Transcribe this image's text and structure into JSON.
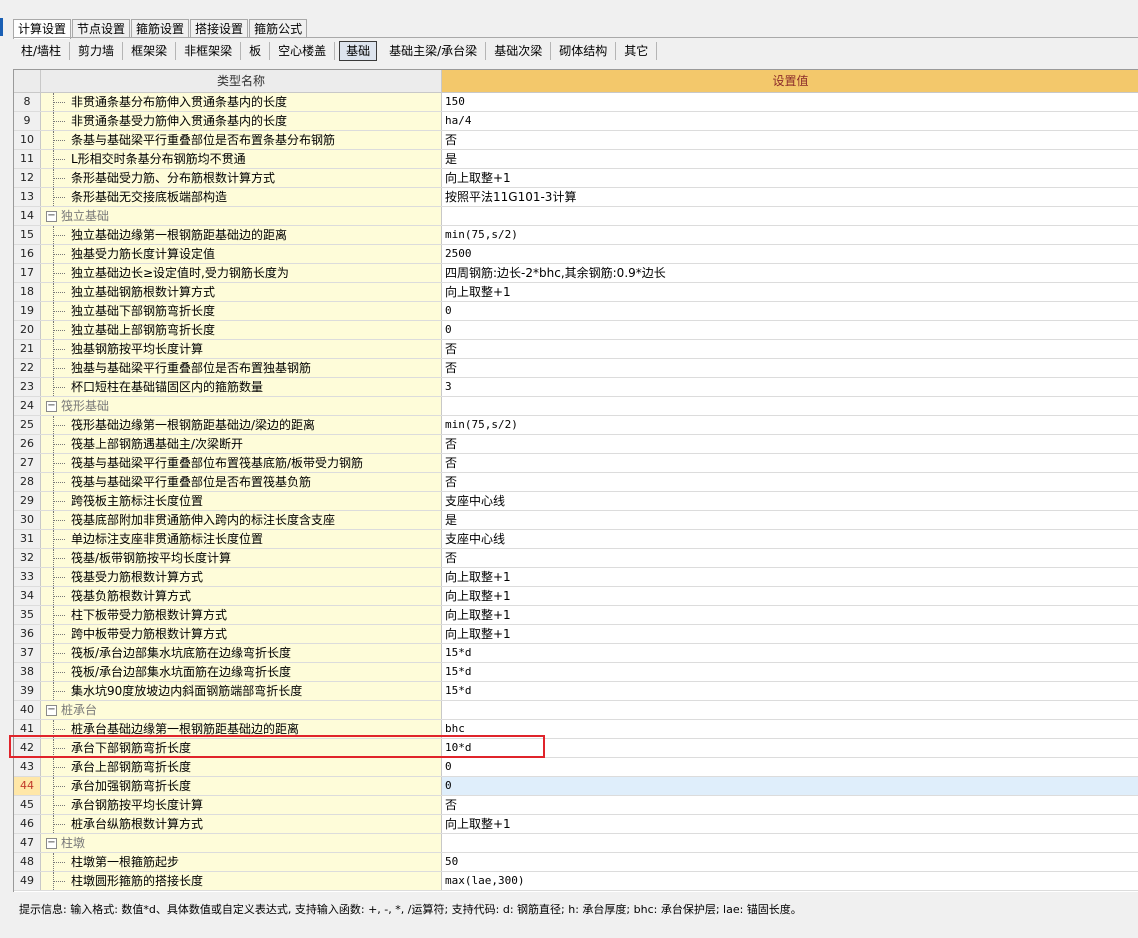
{
  "tabs": [
    {
      "label": "计算设置",
      "active": true
    },
    {
      "label": "节点设置",
      "active": false
    },
    {
      "label": "箍筋设置",
      "active": false
    },
    {
      "label": "搭接设置",
      "active": false
    },
    {
      "label": "箍筋公式",
      "active": false
    }
  ],
  "subtabs": [
    {
      "label": "柱/墙柱",
      "active": false
    },
    {
      "label": "剪力墙",
      "active": false
    },
    {
      "label": "框架梁",
      "active": false
    },
    {
      "label": "非框架梁",
      "active": false
    },
    {
      "label": "板",
      "active": false
    },
    {
      "label": "空心楼盖",
      "active": false
    },
    {
      "label": "基础",
      "active": true
    },
    {
      "label": "基础主梁/承台梁",
      "active": false
    },
    {
      "label": "基础次梁",
      "active": false
    },
    {
      "label": "砌体结构",
      "active": false
    },
    {
      "label": "其它",
      "active": false
    }
  ],
  "grid": {
    "header_name": "类型名称",
    "header_value": "设置值",
    "rows": [
      {
        "num": "8",
        "name": "非贯通条基分布筋伸入贯通条基内的长度",
        "value": "150"
      },
      {
        "num": "9",
        "name": "非贯通条基受力筋伸入贯通条基内的长度",
        "value": "ha/4"
      },
      {
        "num": "10",
        "name": "条基与基础梁平行重叠部位是否布置条基分布钢筋",
        "value": "否"
      },
      {
        "num": "11",
        "name": "L形相交时条基分布钢筋均不贯通",
        "value": "是"
      },
      {
        "num": "12",
        "name": "条形基础受力筋、分布筋根数计算方式",
        "value": "向上取整+1"
      },
      {
        "num": "13",
        "name": "条形基础无交接底板端部构造",
        "value": "按照平法11G101-3计算"
      },
      {
        "num": "14",
        "name": "独立基础",
        "value": "",
        "group": true
      },
      {
        "num": "15",
        "name": "独立基础边缘第一根钢筋距基础边的距离",
        "value": "min(75,s/2)"
      },
      {
        "num": "16",
        "name": "独基受力筋长度计算设定值",
        "value": "2500"
      },
      {
        "num": "17",
        "name": "独立基础边长≥设定值时,受力钢筋长度为",
        "value": "四周钢筋:边长-2*bhc,其余钢筋:0.9*边长"
      },
      {
        "num": "18",
        "name": "独立基础钢筋根数计算方式",
        "value": "向上取整+1"
      },
      {
        "num": "19",
        "name": "独立基础下部钢筋弯折长度",
        "value": "0"
      },
      {
        "num": "20",
        "name": "独立基础上部钢筋弯折长度",
        "value": "0"
      },
      {
        "num": "21",
        "name": "独基钢筋按平均长度计算",
        "value": "否"
      },
      {
        "num": "22",
        "name": "独基与基础梁平行重叠部位是否布置独基钢筋",
        "value": "否"
      },
      {
        "num": "23",
        "name": "杯口短柱在基础锚固区内的箍筋数量",
        "value": "3"
      },
      {
        "num": "24",
        "name": "筏形基础",
        "value": "",
        "group": true
      },
      {
        "num": "25",
        "name": "筏形基础边缘第一根钢筋距基础边/梁边的距离",
        "value": "min(75,s/2)"
      },
      {
        "num": "26",
        "name": "筏基上部钢筋遇基础主/次梁断开",
        "value": "否"
      },
      {
        "num": "27",
        "name": "筏基与基础梁平行重叠部位布置筏基底筋/板带受力钢筋",
        "value": "否"
      },
      {
        "num": "28",
        "name": "筏基与基础梁平行重叠部位是否布置筏基负筋",
        "value": "否"
      },
      {
        "num": "29",
        "name": "跨筏板主筋标注长度位置",
        "value": "支座中心线"
      },
      {
        "num": "30",
        "name": "筏基底部附加非贯通筋伸入跨内的标注长度含支座",
        "value": "是"
      },
      {
        "num": "31",
        "name": "单边标注支座非贯通筋标注长度位置",
        "value": "支座中心线"
      },
      {
        "num": "32",
        "name": "筏基/板带钢筋按平均长度计算",
        "value": "否"
      },
      {
        "num": "33",
        "name": "筏基受力筋根数计算方式",
        "value": "向上取整+1"
      },
      {
        "num": "34",
        "name": "筏基负筋根数计算方式",
        "value": "向上取整+1"
      },
      {
        "num": "35",
        "name": "柱下板带受力筋根数计算方式",
        "value": "向上取整+1"
      },
      {
        "num": "36",
        "name": "跨中板带受力筋根数计算方式",
        "value": "向上取整+1"
      },
      {
        "num": "37",
        "name": "筏板/承台边部集水坑底筋在边缘弯折长度",
        "value": "15*d"
      },
      {
        "num": "38",
        "name": "筏板/承台边部集水坑面筋在边缘弯折长度",
        "value": "15*d"
      },
      {
        "num": "39",
        "name": "集水坑90度放坡边内斜面钢筋端部弯折长度",
        "value": "15*d"
      },
      {
        "num": "40",
        "name": "桩承台",
        "value": "",
        "group": true
      },
      {
        "num": "41",
        "name": "桩承台基础边缘第一根钢筋距基础边的距离",
        "value": "bhc"
      },
      {
        "num": "42",
        "name": "承台下部钢筋弯折长度",
        "value": "10*d"
      },
      {
        "num": "43",
        "name": "承台上部钢筋弯折长度",
        "value": "0"
      },
      {
        "num": "44",
        "name": "承台加强钢筋弯折长度",
        "value": "0",
        "selected": true
      },
      {
        "num": "45",
        "name": "承台钢筋按平均长度计算",
        "value": "否"
      },
      {
        "num": "46",
        "name": "桩承台纵筋根数计算方式",
        "value": "向上取整+1"
      },
      {
        "num": "47",
        "name": "柱墩",
        "value": "",
        "group": true
      },
      {
        "num": "48",
        "name": "柱墩第一根箍筋起步",
        "value": "50"
      },
      {
        "num": "49",
        "name": "柱墩圆形箍筋的搭接长度",
        "value": "max(lae,300)"
      }
    ]
  },
  "status": {
    "text": "提示信息: 输入格式: 数值*d、具体数值或自定义表达式, 支持输入函数: +, -, *, /运算符; 支持代码: d: 钢筋直径; h: 承台厚度; bhc: 承台保护层; lae: 锚固长度。"
  },
  "colors": {
    "header_value_bg": "#f3c86b",
    "name_cell_bg": "#fefcd9",
    "highlight_box": "#e0242b"
  }
}
